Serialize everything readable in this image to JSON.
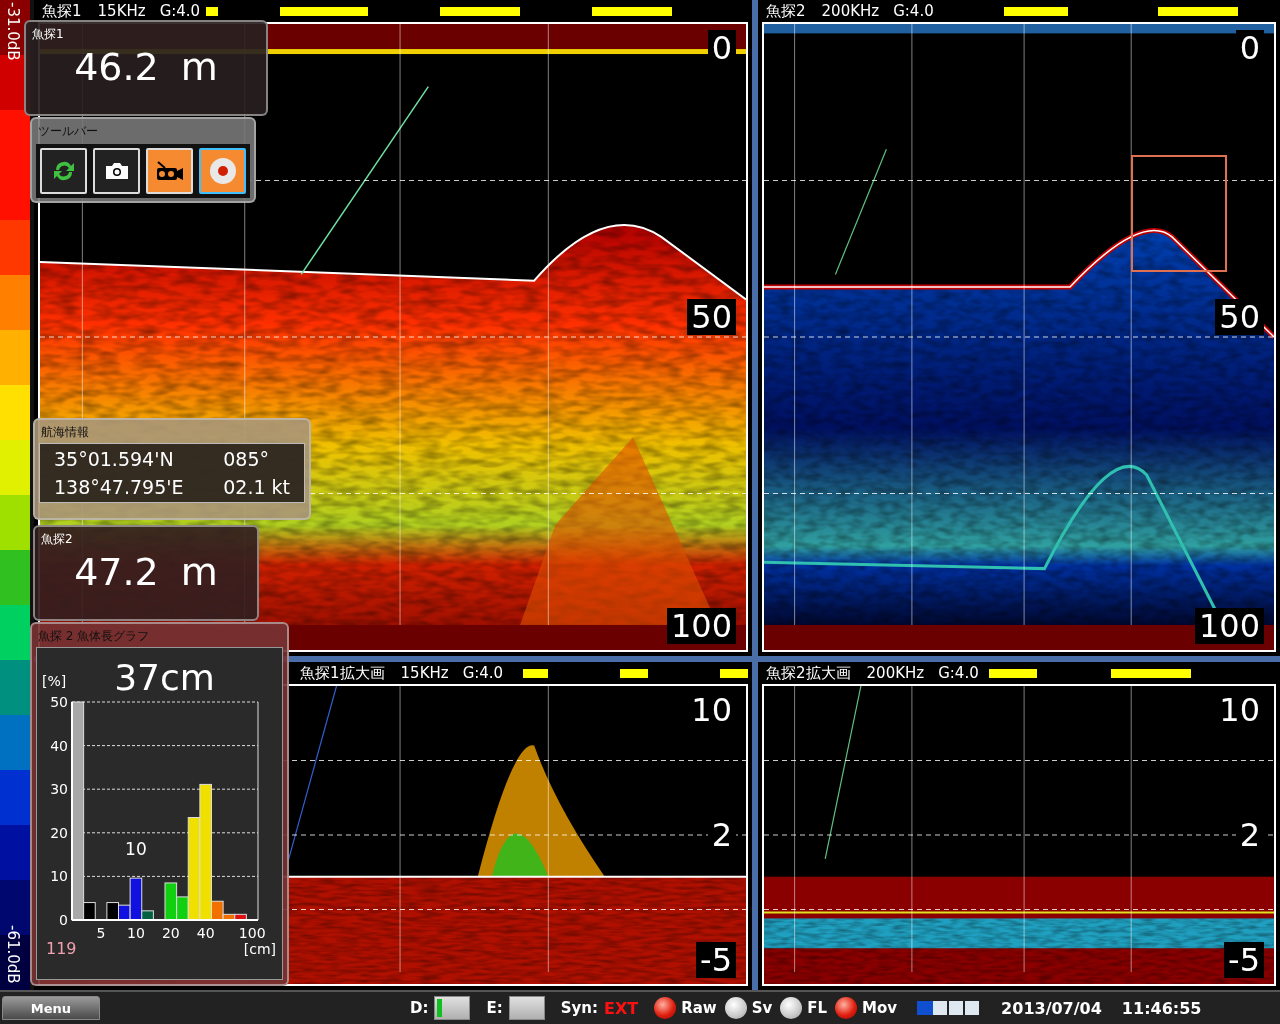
{
  "color_scale": {
    "top_label": "-31.0dB",
    "bottom_label": "-61.0dB"
  },
  "panels": [
    {
      "title": "魚探1",
      "frequency": "15KHz",
      "gain": "G:4.0",
      "kind": "low_freq",
      "zoom_frame": false,
      "depth_labels": [
        "0",
        "50",
        "100"
      ]
    },
    {
      "title": "魚探2",
      "frequency": "200KHz",
      "gain": "G:4.0",
      "kind": "high_freq",
      "zoom_frame": true,
      "depth_labels": [
        "0",
        "50",
        "100"
      ]
    },
    {
      "title": "魚探1拡大画",
      "frequency": "15KHz",
      "gain": "G:4.0",
      "kind": "low_freq_zoom",
      "zoom_frame": false,
      "depth_labels": [
        "10",
        "2",
        "-5"
      ]
    },
    {
      "title": "魚探2拡大画",
      "frequency": "200KHz",
      "gain": "G:4.0",
      "kind": "high_freq_zoom",
      "zoom_frame": false,
      "depth_labels": [
        "10",
        "2",
        "-5"
      ]
    }
  ],
  "depth_readouts": [
    {
      "label": "魚探1",
      "value": "46.2",
      "unit": "m"
    },
    {
      "label": "魚探2",
      "value": "47.2",
      "unit": "m"
    }
  ],
  "toolbar": {
    "title": "ツールバー",
    "buttons": [
      {
        "kind": "refresh",
        "on": false,
        "selected": false
      },
      {
        "kind": "camera",
        "on": false,
        "selected": false
      },
      {
        "kind": "video",
        "on": true,
        "selected": false
      },
      {
        "kind": "record",
        "on": true,
        "selected": true
      }
    ]
  },
  "nav_info": {
    "title": "航海情報",
    "latitude": "35°01.594'N",
    "heading": "085°",
    "longitude": "138°47.795'E",
    "speed": "02.1 kt"
  },
  "length_graph": {
    "title": "魚探 2 魚体長グラフ",
    "reading": "37cm",
    "count": "119",
    "chart_data": {
      "type": "bar",
      "xlabel": "[cm]",
      "ylabel": "[%]",
      "stacked": true,
      "categories": [
        null,
        null,
        "5",
        null,
        null,
        "10",
        null,
        null,
        "20",
        null,
        null,
        "40",
        null,
        null,
        null,
        "100"
      ],
      "ylim": [
        0,
        50
      ],
      "grid": true,
      "yticks": [
        0,
        10,
        20,
        30,
        40,
        50
      ],
      "series": [
        {
          "color": "#a8a8a8",
          "values": [
            50,
            null,
            null,
            null,
            null,
            null,
            null,
            null,
            null,
            null,
            null,
            null,
            null,
            null,
            null,
            null
          ]
        },
        {
          "color": "#000000",
          "values": [
            null,
            4,
            null,
            4,
            null,
            null,
            null,
            null,
            null,
            null,
            null,
            null,
            null,
            null,
            null,
            null
          ]
        },
        {
          "color": "#1010e0",
          "values": [
            null,
            null,
            null,
            null,
            3.4,
            9.6,
            null,
            null,
            null,
            null,
            null,
            null,
            null,
            null,
            null,
            null
          ]
        },
        {
          "color": "#006040",
          "values": [
            null,
            null,
            null,
            null,
            null,
            null,
            2.1,
            null,
            null,
            null,
            null,
            null,
            null,
            null,
            null,
            null
          ]
        },
        {
          "color": "#10d010",
          "values": [
            null,
            null,
            null,
            null,
            null,
            null,
            null,
            null,
            8.5,
            5.3,
            null,
            null,
            null,
            null,
            null,
            null
          ]
        },
        {
          "color": "#f0e000",
          "values": [
            null,
            null,
            null,
            null,
            null,
            null,
            null,
            null,
            null,
            null,
            23.5,
            31.1,
            null,
            null,
            null,
            null
          ]
        },
        {
          "color": "#f07000",
          "values": [
            null,
            null,
            null,
            null,
            null,
            null,
            null,
            null,
            null,
            null,
            null,
            null,
            4.3,
            1.3,
            null,
            null
          ]
        },
        {
          "color": "#e01010",
          "values": [
            null,
            null,
            null,
            null,
            null,
            null,
            null,
            null,
            null,
            null,
            null,
            null,
            null,
            null,
            1.3,
            null
          ]
        }
      ],
      "annotations": [
        "10"
      ]
    }
  },
  "status_bar": {
    "menu_button": "Menu",
    "toggles": [
      {
        "label": "D:",
        "on": true
      },
      {
        "label": "E:",
        "on": false
      }
    ],
    "sync": {
      "label": "Syn:",
      "value": "EXT"
    },
    "indicators": [
      {
        "label": "Raw",
        "on": true
      },
      {
        "label": "Sv",
        "on": false
      },
      {
        "label": "FL",
        "on": false
      },
      {
        "label": "Mov",
        "on": true
      }
    ],
    "buffer": {
      "level": 0.25
    },
    "date": "2013/07/04",
    "time": "11:46:55"
  }
}
